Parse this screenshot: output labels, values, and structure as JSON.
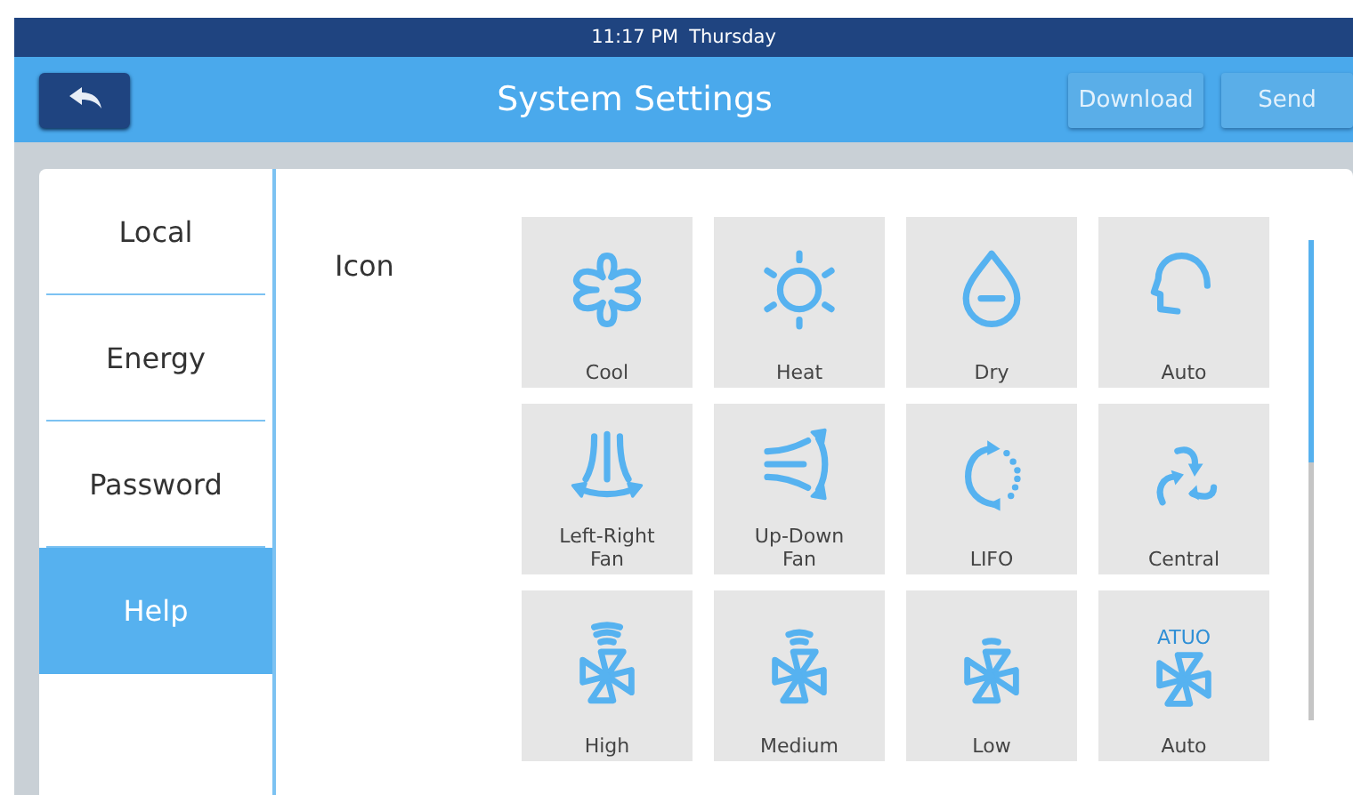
{
  "status_bar": {
    "time": "11:17 PM",
    "day": "Thursday"
  },
  "header": {
    "title": "System Settings",
    "buttons": [
      {
        "label": "Download",
        "disabled": true
      },
      {
        "label": "Send",
        "disabled": true
      }
    ]
  },
  "sidebar": {
    "items": [
      {
        "label": "Local",
        "selected": false
      },
      {
        "label": "Energy",
        "selected": false
      },
      {
        "label": "Password",
        "selected": false
      },
      {
        "label": "Help",
        "selected": true
      }
    ]
  },
  "section_label": "Icon",
  "icons": [
    {
      "kind": "snowflake",
      "label": "Cool"
    },
    {
      "kind": "sun",
      "label": "Heat"
    },
    {
      "kind": "drop",
      "label": "Dry"
    },
    {
      "kind": "head",
      "label": "Auto"
    },
    {
      "kind": "left-right",
      "label": "Left-Right\nFan"
    },
    {
      "kind": "up-down",
      "label": "Up-Down\nFan"
    },
    {
      "kind": "cycle",
      "label": "LIFO"
    },
    {
      "kind": "three-arrows",
      "label": "Central"
    },
    {
      "kind": "fan-high",
      "label": "High"
    },
    {
      "kind": "fan-medium",
      "label": "Medium"
    },
    {
      "kind": "fan-low",
      "label": "Low"
    },
    {
      "kind": "fan-auto",
      "label": "Auto",
      "badge": "ATUO"
    }
  ]
}
